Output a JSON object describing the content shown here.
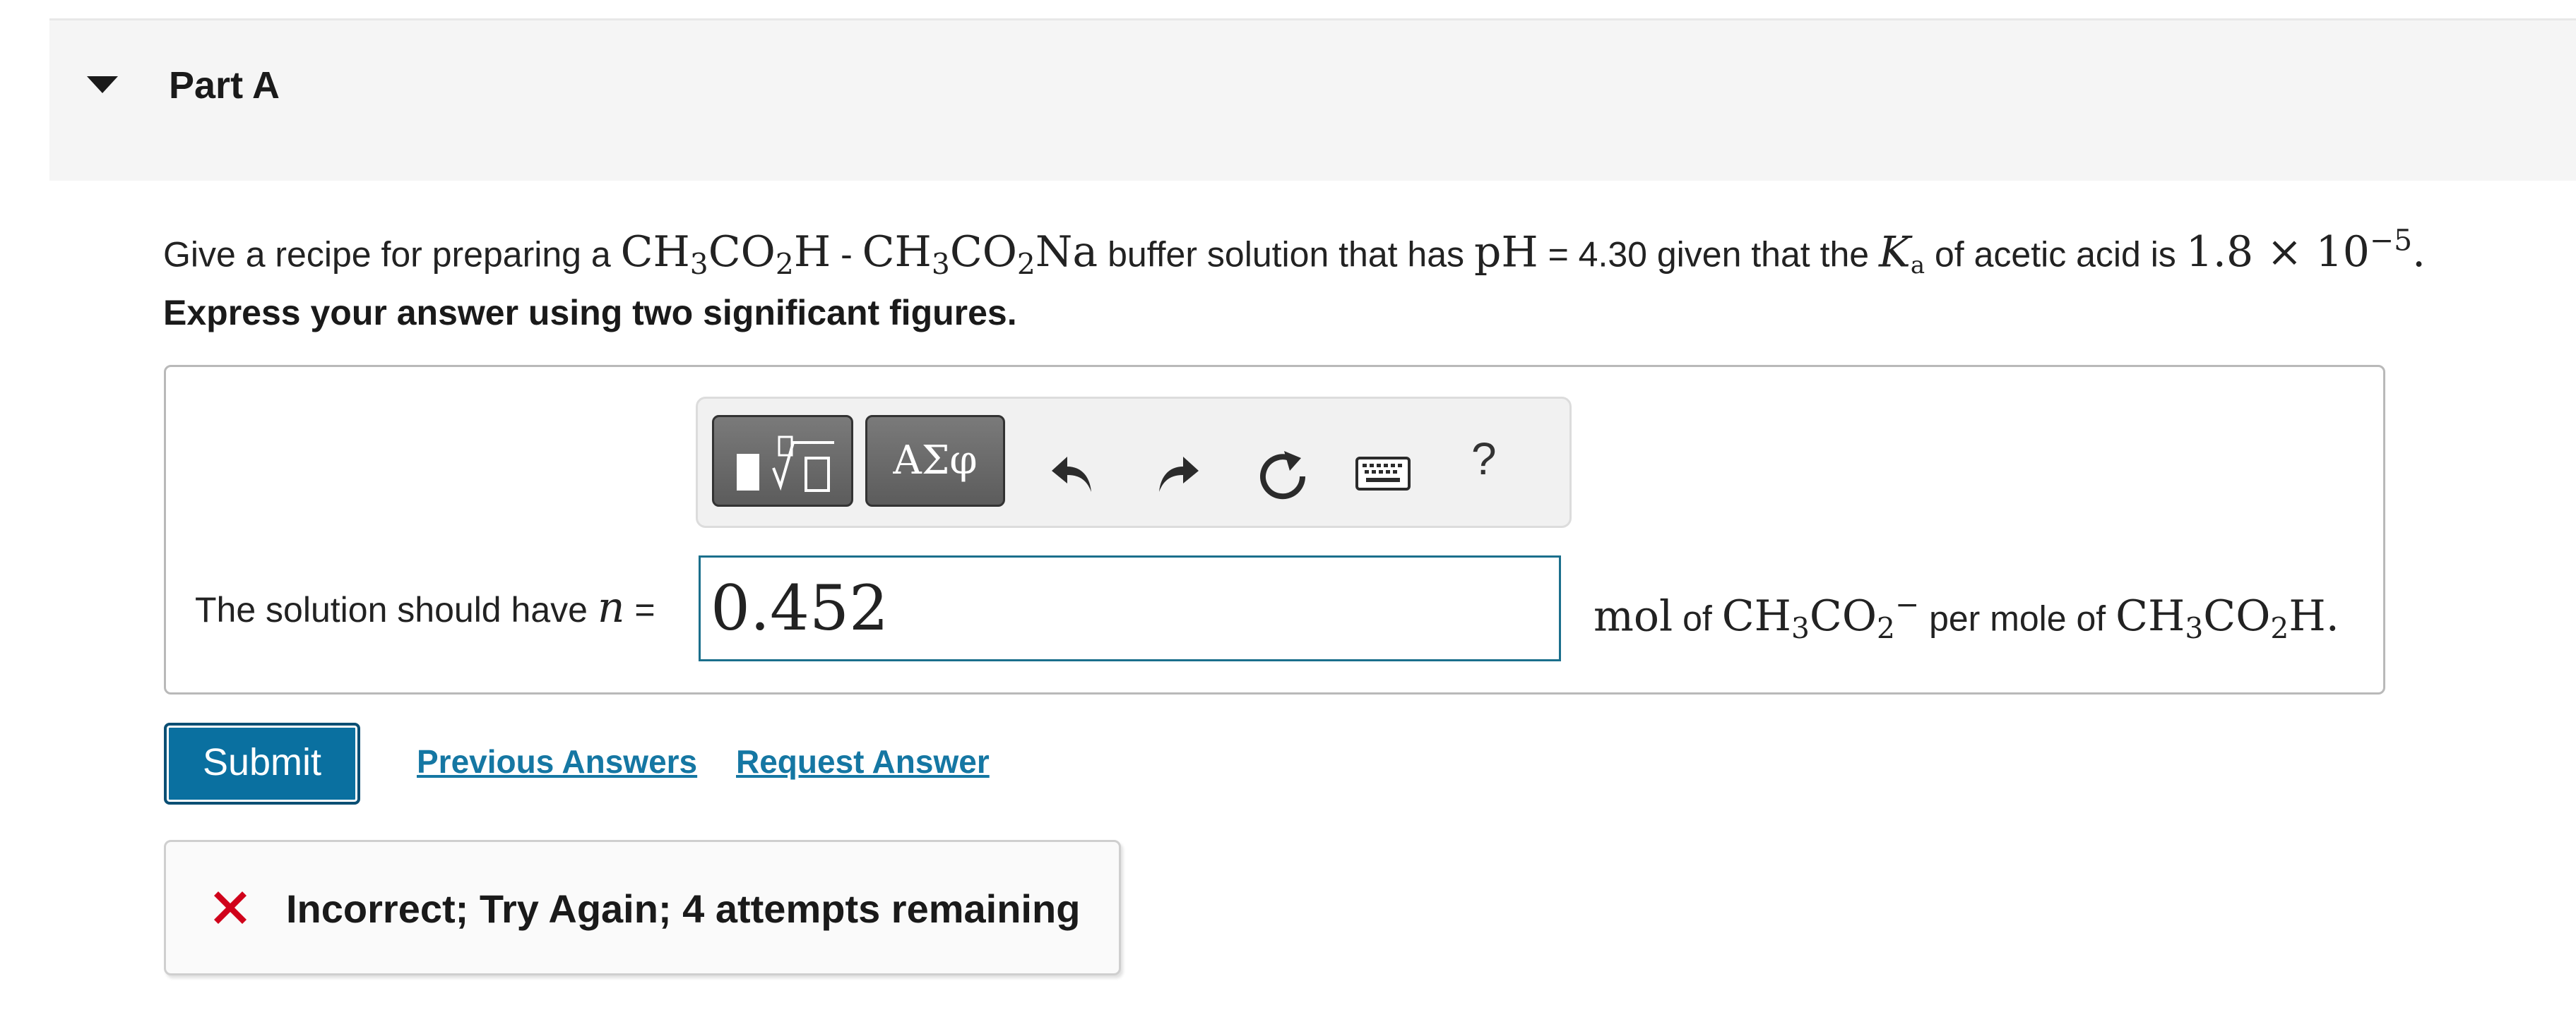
{
  "part": {
    "title": "Part A",
    "expanded": true
  },
  "question": {
    "prefix": "Give a recipe for preparing a ",
    "acid_formula_parts": [
      "CH",
      "3",
      "CO",
      "2",
      "H"
    ],
    "separator": " - ",
    "salt_formula_parts": [
      "CH",
      "3",
      "CO",
      "2",
      "Na"
    ],
    "middle": " buffer solution that has ",
    "ph_symbol": "pH",
    "ph_value": " = 4.30 given that the ",
    "ka_symbol": "K",
    "ka_subscript": "a",
    "ka_text": " of acetic acid is ",
    "ka_mantissa": "1.8 × 10",
    "ka_exponent": "−5",
    "end": "."
  },
  "instruction": "Express your answer using two significant figures.",
  "toolbar": {
    "templates_icon": "templates-icon",
    "symbols_label": "ΑΣφ",
    "undo_icon": "undo-icon",
    "redo_icon": "redo-icon",
    "reset_icon": "reset-icon",
    "keyboard_icon": "keyboard-icon",
    "help_label": "?"
  },
  "answer": {
    "label_prefix": "The solution should have ",
    "variable": "n",
    "label_suffix": " =",
    "value": "0.452",
    "unit_mol": "mol",
    "unit_of": " of ",
    "anion_parts": [
      "CH",
      "3",
      "CO",
      "2",
      "−"
    ],
    "per_mole_of": " per mole of ",
    "acid_parts": [
      "CH",
      "3",
      "CO",
      "2",
      "H"
    ],
    "end": "."
  },
  "actions": {
    "submit_label": "Submit",
    "previous_answers_label": "Previous Answers",
    "request_answer_label": "Request Answer"
  },
  "feedback": {
    "icon": "x-icon",
    "message": "Incorrect; Try Again; 4 attempts remaining",
    "color": "#d0021b"
  }
}
